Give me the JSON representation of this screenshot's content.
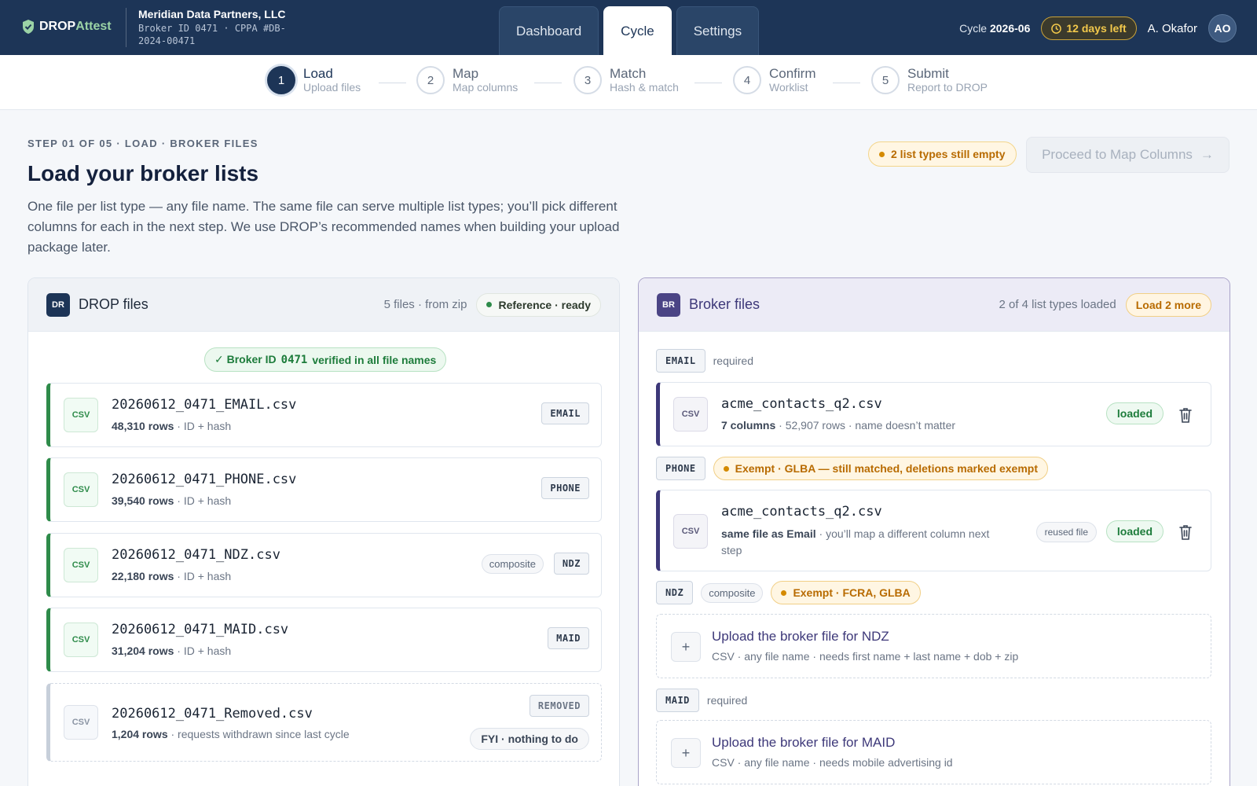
{
  "brand": {
    "name_a": "DROP",
    "name_b": "Attest",
    "accent": "#9bd3a6",
    "nav_bg": "#1d3557"
  },
  "org": {
    "name": "Meridian Data Partners, LLC",
    "meta_1": "Broker ID 0471 · CPPA #DB-",
    "meta_2": "2024-00471"
  },
  "tabs": [
    {
      "label": "Dashboard",
      "active": false
    },
    {
      "label": "Cycle",
      "active": true
    },
    {
      "label": "Settings",
      "active": false
    }
  ],
  "topright": {
    "cycle_prefix": "Cycle",
    "cycle_value": "2026-06",
    "days_left": "12 days left",
    "user_name": "A. Okafor",
    "user_initials": "AO"
  },
  "steps": [
    {
      "num": "1",
      "title": "Load",
      "sub": "Upload files",
      "active": true
    },
    {
      "num": "2",
      "title": "Map",
      "sub": "Map columns",
      "active": false
    },
    {
      "num": "3",
      "title": "Match",
      "sub": "Hash & match",
      "active": false
    },
    {
      "num": "4",
      "title": "Confirm",
      "sub": "Worklist",
      "active": false
    },
    {
      "num": "5",
      "title": "Submit",
      "sub": "Report to DROP",
      "active": false
    }
  ],
  "header": {
    "eyebrow": "STEP 01 OF 05 · LOAD · BROKER FILES",
    "title": "Load your broker lists",
    "description": "One file per list type — any file name. The same file can serve multiple list types; you’ll pick different columns for each in the next step. We use DROP’s recommended names when building your upload package later.",
    "warning": "2 list types still empty",
    "proceed": "Proceed to Map Columns",
    "proceed_arrow": "→"
  },
  "drop_panel": {
    "badge": "DR",
    "badge_color": "#1d3557",
    "title": "DROP files",
    "count": "5 files · from zip",
    "status": "Reference · ready",
    "verified_prefix": "✓ Broker ID",
    "verified_id": "0471",
    "verified_suffix": "verified in all file names",
    "files": [
      {
        "name": "20260612_0471_EMAIL.csv",
        "rows": "48,310 rows",
        "detail": " · ID + hash",
        "tag": "EMAIL",
        "composite": ""
      },
      {
        "name": "20260612_0471_PHONE.csv",
        "rows": "39,540 rows",
        "detail": " · ID + hash",
        "tag": "PHONE",
        "composite": ""
      },
      {
        "name": "20260612_0471_NDZ.csv",
        "rows": "22,180 rows",
        "detail": " · ID + hash",
        "tag": "NDZ",
        "composite": "composite"
      },
      {
        "name": "20260612_0471_MAID.csv",
        "rows": "31,204 rows",
        "detail": " · ID + hash",
        "tag": "MAID",
        "composite": ""
      }
    ],
    "removed": {
      "name": "20260612_0471_Removed.csv",
      "rows": "1,204 rows",
      "detail": " · requests withdrawn since last cycle",
      "tag": "REMOVED",
      "note": "FYI · nothing to do"
    },
    "csv_label": "CSV"
  },
  "broker_panel": {
    "badge": "BR",
    "badge_color": "#4b4485",
    "title": "Broker files",
    "count": "2 of 4 list types loaded",
    "load_more": "Load 2 more",
    "email": {
      "tag": "EMAIL",
      "req": "required",
      "file": "acme_contacts_q2.csv",
      "cols": "7 columns",
      "detail": " · 52,907 rows · name doesn’t matter",
      "status": "loaded"
    },
    "phone": {
      "tag": "PHONE",
      "exempt": "Exempt · GLBA — still matched, deletions marked exempt",
      "file": "acme_contacts_q2.csv",
      "same": "same file as Email",
      "detail": " · you’ll map a different column next step",
      "reused": "reused file",
      "status": "loaded"
    },
    "ndz": {
      "tag": "NDZ",
      "composite": "composite",
      "exempt": "Exempt · FCRA, GLBA",
      "upload_title": "Upload the broker file for NDZ",
      "upload_sub": "CSV · any file name · needs first name + last name + dob + zip"
    },
    "maid": {
      "tag": "MAID",
      "req": "required",
      "upload_title": "Upload the broker file for MAID",
      "upload_sub": "CSV · any file name · needs mobile advertising id"
    },
    "csv_label": "CSV",
    "plus": "+"
  }
}
